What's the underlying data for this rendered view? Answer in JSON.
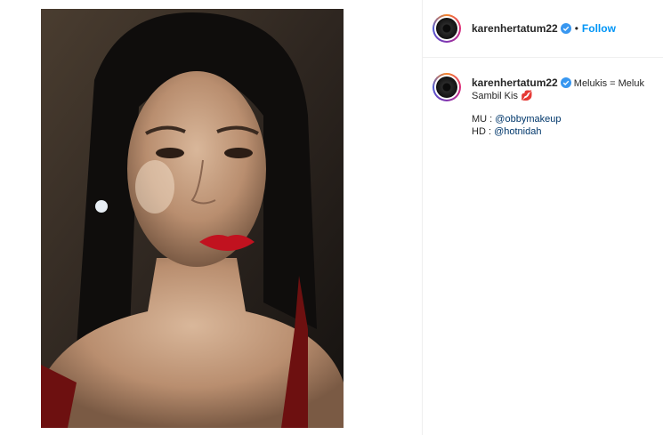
{
  "post": {
    "header": {
      "username": "karenhertatum22",
      "separator": "•",
      "follow_label": "Follow"
    },
    "caption": {
      "username": "karenhertatum22",
      "text": "Melukis = Meluk Sambil Kis",
      "emoji": "💋",
      "credits": [
        {
          "label": "MU :",
          "mention": "@obbymakeup"
        },
        {
          "label": "HD :",
          "mention": "@hotnidah"
        }
      ]
    },
    "icons": {
      "verified": "verified-badge-icon",
      "avatar": "profile-avatar"
    },
    "colors": {
      "link": "#0095f6",
      "mention": "#00376b",
      "text": "#262626",
      "verified": "#3897f0"
    }
  }
}
